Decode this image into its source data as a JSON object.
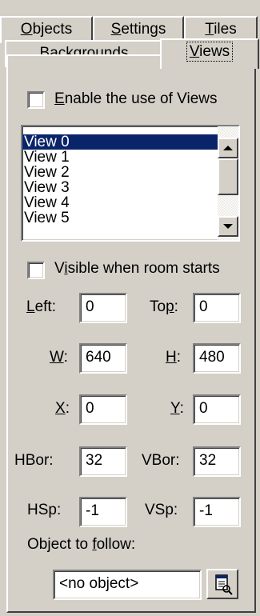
{
  "tabs": {
    "row1": [
      {
        "pre": "",
        "acc": "O",
        "post": "bjects"
      },
      {
        "pre": "",
        "acc": "S",
        "post": "ettings"
      },
      {
        "pre": "",
        "acc": "T",
        "post": "iles"
      }
    ],
    "row2": [
      {
        "pre": "",
        "acc": "B",
        "post": "ackgrounds"
      },
      {
        "pre": "",
        "acc": "V",
        "post": "iews"
      }
    ],
    "selected": "Views"
  },
  "enable_views": {
    "pre": "",
    "acc": "E",
    "post": "nable the use of Views",
    "checked": false
  },
  "views_list": {
    "items": [
      "View 0",
      "View 1",
      "View 2",
      "View 3",
      "View 4",
      "View 5"
    ],
    "selected_index": 0
  },
  "visible_when_starts": {
    "pre": "V",
    "acc": "i",
    "post": "sible when room starts",
    "checked": false
  },
  "fields": {
    "left": {
      "pre": "",
      "acc": "L",
      "post": "eft:",
      "value": "0"
    },
    "top": {
      "pre": "To",
      "acc": "p",
      "post": ":",
      "value": "0"
    },
    "w": {
      "pre": "",
      "acc": "W",
      "post": ":",
      "value": "640"
    },
    "h": {
      "pre": "",
      "acc": "H",
      "post": ":",
      "value": "480"
    },
    "x": {
      "pre": "",
      "acc": "X",
      "post": ":",
      "value": "0"
    },
    "y": {
      "pre": "",
      "acc": "Y",
      "post": ":",
      "value": "0"
    },
    "hbor": {
      "label": "HBor:",
      "value": "32"
    },
    "vbor": {
      "label": "VBor:",
      "value": "32"
    },
    "hsp": {
      "label": "HSp:",
      "value": "-1"
    },
    "vsp": {
      "label": "VSp:",
      "value": "-1"
    }
  },
  "object_to_follow": {
    "pre": "Object to ",
    "acc": "f",
    "post": "ollow:",
    "value": "<no object>"
  },
  "icons": {
    "browse": "object-picker-icon",
    "scroll_up": "arrow-up-icon",
    "scroll_down": "arrow-down-icon"
  },
  "colors": {
    "face": "#d4d0c8",
    "selection": "#0a246a"
  }
}
